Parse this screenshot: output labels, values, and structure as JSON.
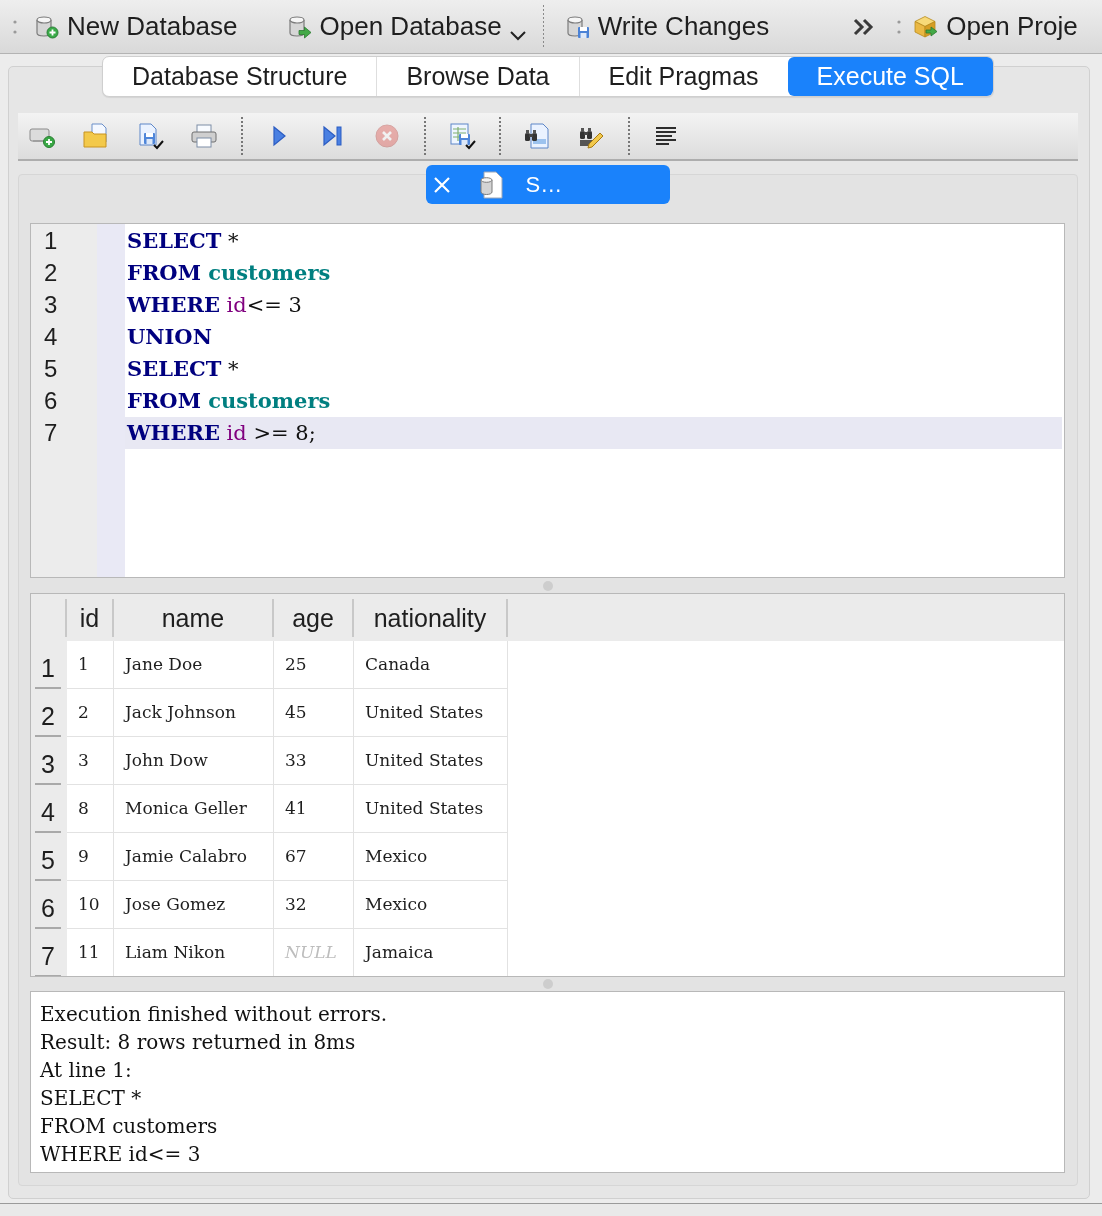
{
  "toolbar": {
    "items": [
      {
        "kind": "grip"
      },
      {
        "kind": "button",
        "label": "New Database"
      },
      {
        "kind": "menu-button",
        "label": "Open Database"
      },
      {
        "kind": "separator"
      },
      {
        "kind": "button",
        "label": "Write Changes"
      },
      {
        "kind": "overflow"
      },
      {
        "kind": "grip"
      },
      {
        "kind": "button",
        "label": "Open Proje"
      }
    ]
  },
  "tabs": [
    {
      "label": "Database Structure",
      "selected": false
    },
    {
      "label": "Browse Data",
      "selected": false
    },
    {
      "label": "Edit Pragmas",
      "selected": false
    },
    {
      "label": "Execute SQL",
      "selected": true
    }
  ],
  "sql_toolbar": {
    "items": [
      {
        "kind": "button",
        "disabled": false
      },
      {
        "kind": "button",
        "disabled": false
      },
      {
        "kind": "menu-button",
        "disabled": false
      },
      {
        "kind": "button",
        "disabled": false
      },
      {
        "kind": "separator"
      },
      {
        "kind": "button",
        "disabled": false
      },
      {
        "kind": "button",
        "disabled": false
      },
      {
        "kind": "button",
        "disabled": true
      },
      {
        "kind": "separator"
      },
      {
        "kind": "menu-button",
        "disabled": false
      },
      {
        "kind": "separator"
      },
      {
        "kind": "button",
        "disabled": false
      },
      {
        "kind": "button",
        "disabled": false
      },
      {
        "kind": "separator"
      },
      {
        "kind": "button",
        "disabled": false
      }
    ]
  },
  "editor_tabs": [
    {
      "label": "S…",
      "selected": true
    }
  ],
  "editor": {
    "lines": [
      {
        "number": "1",
        "current": false,
        "tokens": [
          {
            "kind": "keyword",
            "text": "SELECT"
          },
          {
            "kind": "plain",
            "text": " *"
          }
        ]
      },
      {
        "number": "2",
        "current": false,
        "tokens": [
          {
            "kind": "keyword",
            "text": "FROM"
          },
          {
            "kind": "table",
            "text": " customers"
          }
        ]
      },
      {
        "number": "3",
        "current": false,
        "tokens": [
          {
            "kind": "keyword",
            "text": "WHERE"
          },
          {
            "kind": "column",
            "text": " id"
          },
          {
            "kind": "plain",
            "text": "<= 3"
          }
        ]
      },
      {
        "number": "4",
        "current": false,
        "tokens": [
          {
            "kind": "keyword",
            "text": "UNION"
          }
        ]
      },
      {
        "number": "5",
        "current": false,
        "tokens": [
          {
            "kind": "keyword",
            "text": "SELECT"
          },
          {
            "kind": "plain",
            "text": " *"
          }
        ]
      },
      {
        "number": "6",
        "current": false,
        "tokens": [
          {
            "kind": "keyword",
            "text": "FROM"
          },
          {
            "kind": "table",
            "text": " customers"
          }
        ]
      },
      {
        "number": "7",
        "current": true,
        "tokens": [
          {
            "kind": "keyword",
            "text": "WHERE"
          },
          {
            "kind": "column",
            "text": " id"
          },
          {
            "kind": "plain",
            "text": " >= 8;"
          }
        ]
      }
    ]
  },
  "results": {
    "columns": [
      "id",
      "name",
      "age",
      "nationality"
    ],
    "rows": [
      {
        "number": "1",
        "cells": [
          {
            "kind": "value",
            "text": "1"
          },
          {
            "kind": "value",
            "text": "Jane Doe"
          },
          {
            "kind": "value",
            "text": "25"
          },
          {
            "kind": "value",
            "text": "Canada"
          }
        ]
      },
      {
        "number": "2",
        "cells": [
          {
            "kind": "value",
            "text": "2"
          },
          {
            "kind": "value",
            "text": "Jack Johnson"
          },
          {
            "kind": "value",
            "text": "45"
          },
          {
            "kind": "value",
            "text": "United States"
          }
        ]
      },
      {
        "number": "3",
        "cells": [
          {
            "kind": "value",
            "text": "3"
          },
          {
            "kind": "value",
            "text": "John Dow"
          },
          {
            "kind": "value",
            "text": "33"
          },
          {
            "kind": "value",
            "text": "United States"
          }
        ]
      },
      {
        "number": "4",
        "cells": [
          {
            "kind": "value",
            "text": "8"
          },
          {
            "kind": "value",
            "text": "Monica Geller"
          },
          {
            "kind": "value",
            "text": "41"
          },
          {
            "kind": "value",
            "text": "United States"
          }
        ]
      },
      {
        "number": "5",
        "cells": [
          {
            "kind": "value",
            "text": "9"
          },
          {
            "kind": "value",
            "text": "Jamie Calabro"
          },
          {
            "kind": "value",
            "text": "67"
          },
          {
            "kind": "value",
            "text": "Mexico"
          }
        ]
      },
      {
        "number": "6",
        "cells": [
          {
            "kind": "value",
            "text": "10"
          },
          {
            "kind": "value",
            "text": "Jose Gomez"
          },
          {
            "kind": "value",
            "text": "32"
          },
          {
            "kind": "value",
            "text": "Mexico"
          }
        ]
      },
      {
        "number": "7",
        "cells": [
          {
            "kind": "value",
            "text": "11"
          },
          {
            "kind": "value",
            "text": "Liam Nikon"
          },
          {
            "kind": "null",
            "text": "NULL"
          },
          {
            "kind": "value",
            "text": "Jamaica"
          }
        ]
      }
    ]
  },
  "messages": [
    "Execution finished without errors.",
    "Result: 8 rows returned in 8ms",
    "At line 1:",
    "SELECT *",
    "FROM customers",
    "WHERE id<= 3"
  ]
}
